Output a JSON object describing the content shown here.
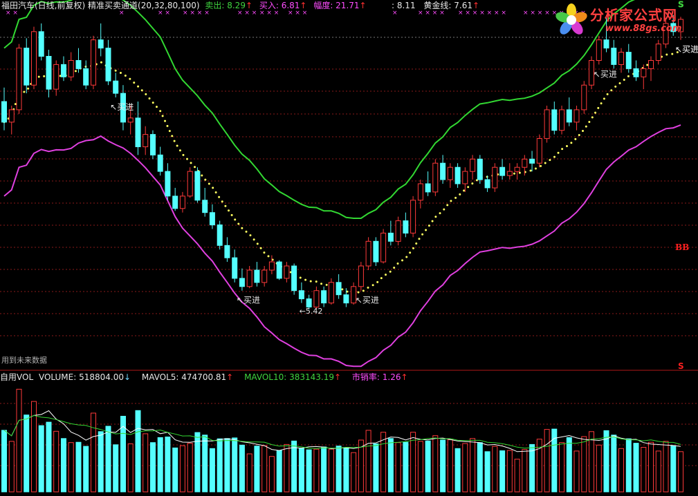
{
  "header": {
    "title": "福田汽车(日线,前复权)",
    "indicator": "精准买卖通道(20,32,80,100)",
    "sell_label": "卖出: 8.29",
    "buy_label": "买入: 6.81",
    "range_label": "幅度: 21.71",
    "val_811": ": 8.11",
    "gold_label": "黄金线: 7.61",
    "arrow": "↑"
  },
  "volume_header": {
    "name": "自用VOL",
    "volume": "VOLUME: 518804.00",
    "volume_arrow": "↓",
    "mavol5": "MAVOL5: 474700.81",
    "mavol10": "MAVOL10: 383143.19",
    "psr": "市销率: 1.26",
    "up_arrow": "↑"
  },
  "logo": {
    "text": "分析家公式网",
    "url": "www.88gs.com"
  },
  "future_note": "用到未来数据",
  "cross_marks": [
    "× ×",
    "×",
    "× ×",
    "× × × ×",
    "× × ×",
    "× × ×",
    "× × ×",
    "×",
    "× × × ×",
    "× × × × × × ×",
    "× × × × × × × × ×"
  ],
  "colors": {
    "up": "#ff3a3a",
    "down": "#54ffff",
    "yellow": "#ffee33",
    "green_line": "#32d832",
    "magenta_line": "#e040e0",
    "dots": "#ffff60",
    "grid": "#8b1a1a",
    "signal_s": "#3fd43f",
    "signal_b": "#ff2020"
  },
  "chart_data": [
    {
      "type": "candlestick",
      "title": "福田汽车(日线,前复权)",
      "indicator": "精准买卖通道(20,32,80,100)",
      "ylim": [
        4.9,
        9.0
      ],
      "low_label": "5.42",
      "annotations": [
        {
          "text": "买进",
          "index": 15
        },
        {
          "text": "买进",
          "index": 32
        },
        {
          "text": "买进",
          "index": 48
        },
        {
          "text": "买进",
          "index": 80
        },
        {
          "text": "买进",
          "index": 101
        },
        {
          "text": "买进",
          "index": 124
        },
        {
          "text": "S",
          "index": 96
        },
        {
          "text": "S",
          "index": 111
        },
        {
          "text": "S",
          "index": 116
        },
        {
          "text": "BB",
          "index": 124
        },
        {
          "text": "S",
          "index": 124
        }
      ],
      "ohlc": [
        [
          7.95,
          8.12,
          7.6,
          7.7
        ],
        [
          7.7,
          7.9,
          7.55,
          7.85
        ],
        [
          7.85,
          8.65,
          7.8,
          8.6
        ],
        [
          8.6,
          8.72,
          8.05,
          8.15
        ],
        [
          8.15,
          8.86,
          8.1,
          8.8
        ],
        [
          8.8,
          8.9,
          8.45,
          8.5
        ],
        [
          8.5,
          8.58,
          8.0,
          8.1
        ],
        [
          8.1,
          8.45,
          8.02,
          8.4
        ],
        [
          8.4,
          8.5,
          8.2,
          8.25
        ],
        [
          8.25,
          8.55,
          8.2,
          8.45
        ],
        [
          8.45,
          8.6,
          8.3,
          8.35
        ],
        [
          8.35,
          8.45,
          8.1,
          8.15
        ],
        [
          8.15,
          8.75,
          8.1,
          8.7
        ],
        [
          8.7,
          8.9,
          8.5,
          8.6
        ],
        [
          8.6,
          8.7,
          8.15,
          8.2
        ],
        [
          8.2,
          8.3,
          8.0,
          8.05
        ],
        [
          8.05,
          8.15,
          7.6,
          7.7
        ],
        [
          7.7,
          7.9,
          7.55,
          7.75
        ],
        [
          7.75,
          7.95,
          7.3,
          7.4
        ],
        [
          7.4,
          7.65,
          7.3,
          7.55
        ],
        [
          7.55,
          7.6,
          7.25,
          7.3
        ],
        [
          7.3,
          7.4,
          7.05,
          7.1
        ],
        [
          7.1,
          7.2,
          6.75,
          6.8
        ],
        [
          6.8,
          6.9,
          6.62,
          6.65
        ],
        [
          6.65,
          6.85,
          6.6,
          6.8
        ],
        [
          6.8,
          7.15,
          6.78,
          7.1
        ],
        [
          7.1,
          7.15,
          6.72,
          6.75
        ],
        [
          6.75,
          6.9,
          6.55,
          6.6
        ],
        [
          6.6,
          6.7,
          6.4,
          6.45
        ],
        [
          6.45,
          6.5,
          6.15,
          6.2
        ],
        [
          6.2,
          6.3,
          6.0,
          6.05
        ],
        [
          6.05,
          6.15,
          5.75,
          5.8
        ],
        [
          5.8,
          5.92,
          5.65,
          5.7
        ],
        [
          5.7,
          5.95,
          5.68,
          5.9
        ],
        [
          5.9,
          6.0,
          5.7,
          5.75
        ],
        [
          5.75,
          5.95,
          5.7,
          5.9
        ],
        [
          5.9,
          6.08,
          5.85,
          6.0
        ],
        [
          6.0,
          6.02,
          5.78,
          5.8
        ],
        [
          5.8,
          6.0,
          5.75,
          5.95
        ],
        [
          5.95,
          5.98,
          5.6,
          5.65
        ],
        [
          5.65,
          5.75,
          5.5,
          5.55
        ],
        [
          5.55,
          5.6,
          5.42,
          5.45
        ],
        [
          5.45,
          5.7,
          5.42,
          5.65
        ],
        [
          5.65,
          5.7,
          5.45,
          5.5
        ],
        [
          5.5,
          5.8,
          5.48,
          5.75
        ],
        [
          5.75,
          5.85,
          5.55,
          5.6
        ],
        [
          5.6,
          5.68,
          5.45,
          5.5
        ],
        [
          5.5,
          5.75,
          5.48,
          5.7
        ],
        [
          5.7,
          6.0,
          5.65,
          5.95
        ],
        [
          5.95,
          6.3,
          5.9,
          6.25
        ],
        [
          6.25,
          6.3,
          5.95,
          6.0
        ],
        [
          6.0,
          6.4,
          5.98,
          6.35
        ],
        [
          6.35,
          6.5,
          6.2,
          6.25
        ],
        [
          6.25,
          6.55,
          6.2,
          6.5
        ],
        [
          6.5,
          6.6,
          6.3,
          6.35
        ],
        [
          6.35,
          6.8,
          6.3,
          6.75
        ],
        [
          6.75,
          7.0,
          6.65,
          6.95
        ],
        [
          6.95,
          7.1,
          6.8,
          6.85
        ],
        [
          6.85,
          7.25,
          6.8,
          7.2
        ],
        [
          7.2,
          7.3,
          6.95,
          7.0
        ],
        [
          7.0,
          7.2,
          6.9,
          7.15
        ],
        [
          7.15,
          7.2,
          6.9,
          6.95
        ],
        [
          6.95,
          7.15,
          6.85,
          7.1
        ],
        [
          7.1,
          7.3,
          7.0,
          7.25
        ],
        [
          7.25,
          7.3,
          6.95,
          7.0
        ],
        [
          7.0,
          7.05,
          6.85,
          6.9
        ],
        [
          6.9,
          7.2,
          6.85,
          7.15
        ],
        [
          7.15,
          7.25,
          7.0,
          7.05
        ],
        [
          7.05,
          7.2,
          7.0,
          7.1
        ],
        [
          7.1,
          7.2,
          7.0,
          7.15
        ],
        [
          7.15,
          7.3,
          7.05,
          7.25
        ],
        [
          7.25,
          7.35,
          7.1,
          7.2
        ],
        [
          7.2,
          7.55,
          7.15,
          7.5
        ],
        [
          7.5,
          7.9,
          7.45,
          7.85
        ],
        [
          7.85,
          7.95,
          7.55,
          7.6
        ],
        [
          7.6,
          7.9,
          7.55,
          7.85
        ],
        [
          7.85,
          8.0,
          7.65,
          7.7
        ],
        [
          7.7,
          7.9,
          7.6,
          7.85
        ],
        [
          7.85,
          8.2,
          7.8,
          8.15
        ],
        [
          8.15,
          8.5,
          8.1,
          8.45
        ],
        [
          8.45,
          8.75,
          8.4,
          8.7
        ],
        [
          8.7,
          9.0,
          8.55,
          8.6
        ],
        [
          8.6,
          8.7,
          8.35,
          8.4
        ],
        [
          8.4,
          8.6,
          8.3,
          8.55
        ],
        [
          8.55,
          8.65,
          8.3,
          8.35
        ],
        [
          8.35,
          8.45,
          8.2,
          8.25
        ],
        [
          8.25,
          8.4,
          8.1,
          8.35
        ],
        [
          8.35,
          8.5,
          8.2,
          8.45
        ],
        [
          8.45,
          8.7,
          8.4,
          8.65
        ],
        [
          8.65,
          8.95,
          8.6,
          8.9
        ],
        [
          8.9,
          9.0,
          8.75,
          8.8
        ],
        [
          8.8,
          8.98,
          8.7,
          8.95
        ]
      ]
    },
    {
      "type": "bar",
      "title": "自用VOL",
      "ylabel": "VOLUME",
      "series": [
        {
          "name": "VOLUME",
          "values": [
            518804.0
          ]
        },
        {
          "name": "MAVOL5",
          "values": [
            474700.81
          ]
        },
        {
          "name": "MAVOL10",
          "values": [
            383143.19
          ]
        }
      ]
    }
  ]
}
